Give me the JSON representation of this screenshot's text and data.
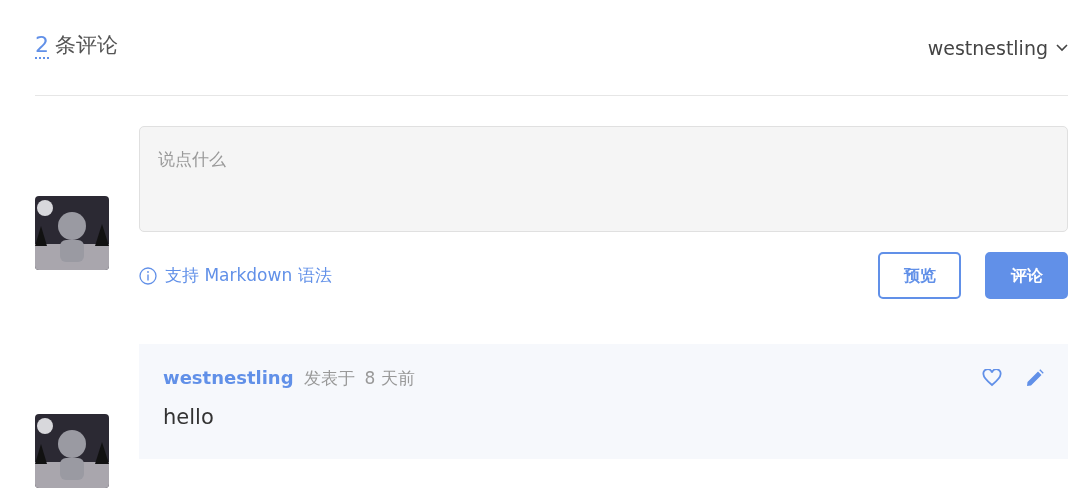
{
  "header": {
    "count": "2",
    "label": "条评论",
    "user": "westnestling"
  },
  "editor": {
    "placeholder": "说点什么",
    "hint": "支持 Markdown 语法",
    "buttons": [
      {
        "label": "预览",
        "kind": "outline"
      },
      {
        "label": "评论",
        "kind": "primary"
      }
    ]
  },
  "comments": [
    {
      "author": "westnestling",
      "meta": "发表于",
      "time": "8 天前",
      "body": "hello",
      "liked": false
    }
  ]
}
